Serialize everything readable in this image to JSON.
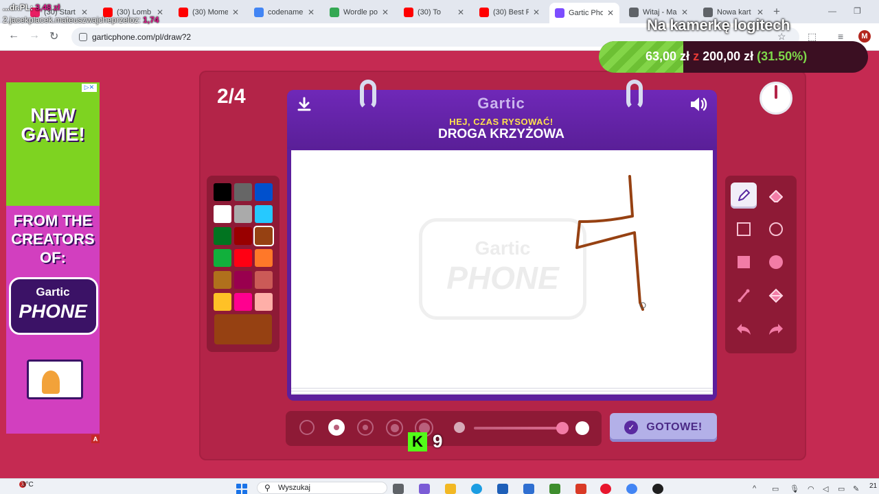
{
  "browser": {
    "tabs": [
      {
        "label": "(30) Start",
        "color": "#e91e63"
      },
      {
        "label": "(30) Lomb",
        "color": "#ff0000"
      },
      {
        "label": "(30) Mome",
        "color": "#ff0000"
      },
      {
        "label": "codename",
        "color": "#4285f4"
      },
      {
        "label": "Wordle po",
        "color": "#34a853"
      },
      {
        "label": "(30) To",
        "color": "#ff0000"
      },
      {
        "label": "(30) Best F",
        "color": "#ff0000"
      },
      {
        "label": "Gartic Pho",
        "color": "#7c4dff"
      },
      {
        "label": "Witaj - Ma",
        "color": "#5f6368"
      },
      {
        "label": "Nowa kart",
        "color": "#5f6368"
      }
    ],
    "url": "garticphone.com/pl/draw?2",
    "profile_initial": "M"
  },
  "overlay": {
    "donation_top": {
      "user": "...dr.PL:",
      "amount": "3,48 zł"
    },
    "donation_line2": {
      "text": "2.jacekplacek.mateuszwajcheprzeloz:",
      "amount": "1,74"
    },
    "camera_label": "Na kamerkę logitech",
    "goal": {
      "current": "63,00 zł",
      "separator": "z",
      "target": "200,00 zł",
      "percent_text": "(31.50%)",
      "progress": 0.315
    },
    "kick": {
      "logo": "K",
      "count": "9"
    }
  },
  "ad": {
    "title": "NEW GAME!",
    "from": "FROM THE CREATORS OF:",
    "logo_top": "Gartic",
    "logo_bottom": "PHONE",
    "badge": "A"
  },
  "game": {
    "round": "2/4",
    "logo": "Gartic",
    "subtitle": "HEJ, CZAS RYSOWAĆ!",
    "phrase": "DROGA KRZYŻOWA",
    "watermark_top": "Gartic",
    "watermark_bottom": "PHONE",
    "done_label": "GOTOWE!",
    "palette": {
      "colors": [
        "#000000",
        "#666666",
        "#0050cd",
        "#ffffff",
        "#aaaaaa",
        "#26c9ff",
        "#017420",
        "#990000",
        "#964112",
        "#11b03c",
        "#ff0013",
        "#ff7829",
        "#b0701c",
        "#99004e",
        "#cb5a57",
        "#ffc126",
        "#ff008f",
        "#feafa8"
      ],
      "selected_index": 8,
      "current": "#964112"
    },
    "tools": [
      "pencil-icon",
      "eraser-icon",
      "rectangle-outline-icon",
      "circle-outline-icon",
      "rectangle-filled-icon",
      "circle-filled-icon",
      "line-icon",
      "fill-bucket-icon",
      "undo-icon",
      "redo-icon"
    ],
    "brush_sizes": 5,
    "selected_size_index": 1
  },
  "taskbar": {
    "weather": "3°C",
    "search_placeholder": "Wyszukaj",
    "time": "21"
  }
}
